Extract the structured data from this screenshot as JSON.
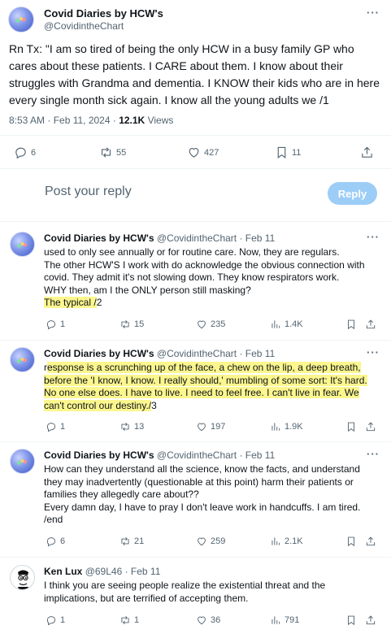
{
  "main_tweet": {
    "author": "Covid Diaries by HCW's",
    "handle": "@CovidintheChart",
    "text": "Rn Tx: \"I am so tired of being the only HCW in a busy family GP who cares about these patients. I CARE about them. I know about their struggles with Grandma and dementia. I KNOW their kids who are in here every single month sick again. I know all the young adults we /1",
    "time": "8:53 AM · Feb 11, 2024 · ",
    "views_count": "12.1K",
    "views_label": "Views",
    "replies": "6",
    "retweets": "55",
    "likes": "427",
    "bookmarks": "11"
  },
  "reply_box": {
    "placeholder": "Post your reply",
    "button": "Reply"
  },
  "replies": [
    {
      "author": "Covid Diaries by HCW's",
      "handle": "@CovidintheChart · Feb 11",
      "text_plain": "used to only see annually or for routine care. Now, they are regulars.\nThe other HCW'S I work with do acknowledge the obvious connection with covid.  They admit it's not slowing down. They know respirators work.\n WHY then, am I the ONLY person still masking?\n",
      "text_highlight": "The typical /",
      "text_tail": "2",
      "replies": "1",
      "retweets": "15",
      "likes": "235",
      "views": "1.4K"
    },
    {
      "author": "Covid Diaries by HCW's",
      "handle": "@CovidintheChart · Feb 11",
      "text_lead": "r",
      "text_highlight": "esponse is a scrunching up of the face, a chew on the lip, a deep breath, before the 'I know, I know. I really should,' mumbling of some sort: It's hard. No one else does. I have to live.  I need to feel free. I can't live in fear. We can't control our destiny./",
      "text_tail": "3",
      "replies": "1",
      "retweets": "13",
      "likes": "197",
      "views": "1.9K"
    },
    {
      "author": "Covid Diaries by HCW's",
      "handle": "@CovidintheChart · Feb 11",
      "text_plain": "How can they understand all the science, know the facts, and understand they may inadvertently (questionable at this point) harm their patients or families they allegedly care about??\nEvery damn day, I have to pray I don't leave work in handcuffs. I am tired.\n/end",
      "replies": "6",
      "retweets": "21",
      "likes": "259",
      "views": "2.1K"
    },
    {
      "author": "Ken Lux",
      "handle": "@69L46 · Feb 11",
      "text_plain": "I think you are seeing people realize the existential threat and the implications, but are terrified of accepting them.",
      "replies": "1",
      "retweets": "1",
      "likes": "36",
      "views": "791"
    }
  ],
  "more_glyph": "···",
  "colors": {
    "text": "#0f1419",
    "secondary": "#536471",
    "highlight": "#fbf68e",
    "reply_button": "#9ccdf7"
  },
  "icons": [
    "reply-icon",
    "retweet-icon",
    "like-icon",
    "views-icon",
    "bookmark-icon",
    "share-icon",
    "more-icon"
  ]
}
